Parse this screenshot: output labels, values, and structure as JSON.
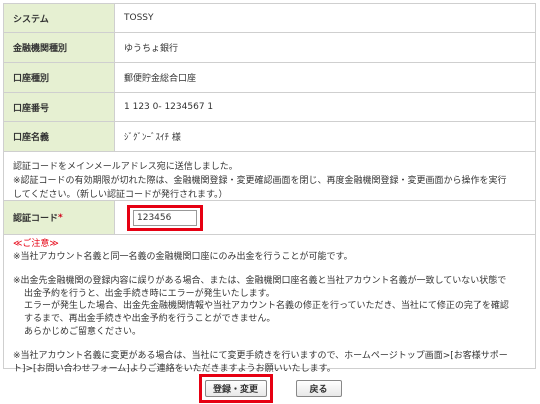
{
  "account": {
    "system_label": "システム",
    "system_value": "TOSSY",
    "inst_type_label": "金融機関種別",
    "inst_type_value": "ゆうちょ銀行",
    "acct_type_label": "口座種別",
    "acct_type_value": "郵便貯金総合口座",
    "acct_no_label": "口座番号",
    "acct_no_value": "1 123 0- 1234567 1",
    "acct_name_label": "口座名義",
    "acct_name_value": "ｼﾞｸﾞﾝｰﾞｽｲﾁ 様"
  },
  "send_notice": {
    "line1": "認証コードをメインメールアドレス宛に送信しました。",
    "line2": "※認証コードの有効期限が切れた際は、金融機関登録・変更確認画面を閉じ、再度金融機関登録・変更画面から操作を実行",
    "line3": "してください。（新しい認証コードが発行されます。）"
  },
  "auth_code": {
    "label": "認証コード",
    "required_mark": "*",
    "value": "123456"
  },
  "caution": {
    "head": "≪ご注意≫",
    "p1": "※当社アカウント名義と同一名義の金融機関口座にのみ出金を行うことが可能です。",
    "p2_l1": "※出金先金融機関の登録内容に誤りがある場合、または、金融機関口座名義と当社アカウント名義が一致していない状態で",
    "p2_l2": "出金予約を行うと、出金手続き時にエラーが発生いたします。",
    "p2_l3": "エラーが発生した場合、出金先金融機関情報や当社アカウント名義の修正を行っていただき、当社にて修正の完了を確認",
    "p2_l4": "するまで、再出金手続きや出金予約を行うことができません。",
    "p2_l5": "あらかじめご留意ください。",
    "p3_l1": "※当社アカウント名義に変更がある場合は、当社にて変更手続きを行いますので、ホームページトップ画面>[お客様サポー",
    "p3_l2": "ト]>[お問い合わせフォーム]よりご連絡をいただきますようお願いいたします。"
  },
  "buttons": {
    "register": "登録・変更",
    "back": "戻る"
  },
  "colors": {
    "label_bg": "#e6f0d2",
    "highlight": "#e60012"
  }
}
